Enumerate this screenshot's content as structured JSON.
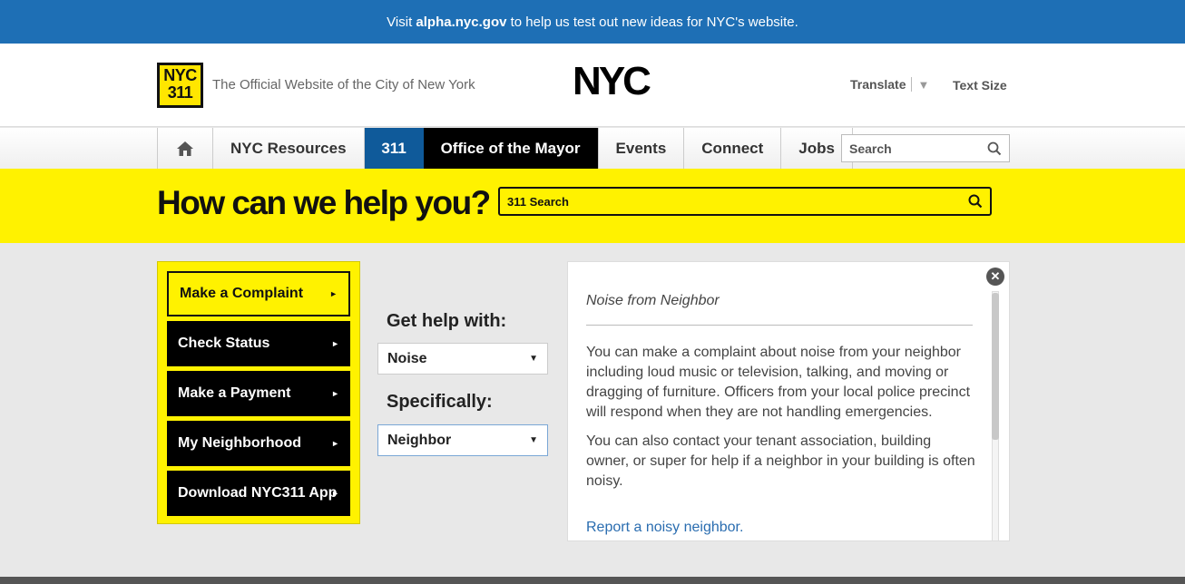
{
  "banner": {
    "prefix": "Visit ",
    "link": "alpha.nyc.gov",
    "suffix": " to help us test out new ideas for NYC's website."
  },
  "header": {
    "logo311_line1": "NYC",
    "logo311_line2": "311",
    "tagline": "The Official Website of the City of New York",
    "nyc_logo": "NYC",
    "translate": "Translate",
    "text_size": "Text Size"
  },
  "nav": {
    "items": [
      {
        "label": "NYC Resources"
      },
      {
        "label": "311"
      },
      {
        "label": "Office of the Mayor"
      },
      {
        "label": "Events"
      },
      {
        "label": "Connect"
      },
      {
        "label": "Jobs"
      }
    ],
    "search_placeholder": "Search"
  },
  "help": {
    "title": "How can we help you?",
    "search_placeholder": "311 Search"
  },
  "actions": [
    {
      "label": "Make a Complaint"
    },
    {
      "label": "Check Status"
    },
    {
      "label": "Make a Payment"
    },
    {
      "label": "My Neighborhood"
    },
    {
      "label": "Download NYC311 App"
    }
  ],
  "form": {
    "get_help_label": "Get help with:",
    "get_help_value": "Noise",
    "specifically_label": "Specifically:",
    "specifically_value": "Neighbor"
  },
  "detail": {
    "title": "Noise from Neighbor",
    "paragraph1": "You can make a complaint about noise from your neighbor including loud music or television, talking, and moving or dragging of furniture. Officers from your local police precinct will respond when they are not handling emergencies.",
    "paragraph2": "You can also contact your tenant association, building owner, or super for help if a neighbor in your building is often noisy.",
    "link": "Report a noisy neighbor."
  },
  "colors": {
    "banner": "#1e6fb5",
    "yellow": "#fff200",
    "nav311": "#0f5a9a",
    "link": "#2a6db0"
  }
}
